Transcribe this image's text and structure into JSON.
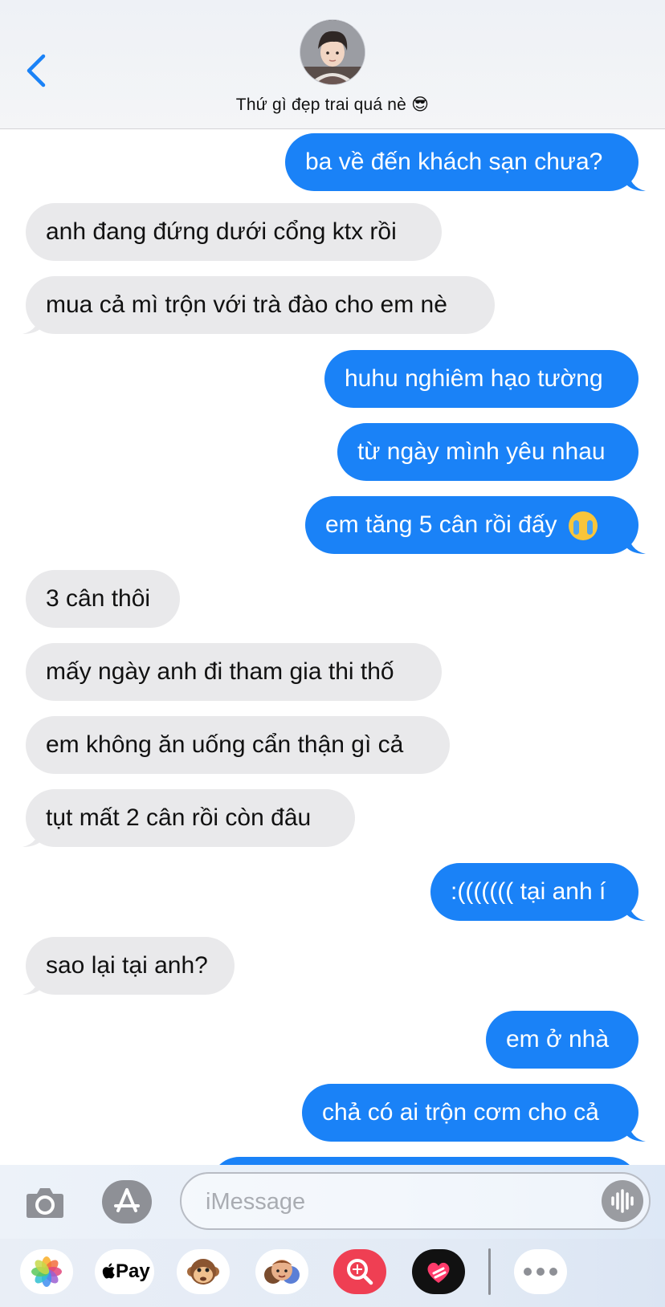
{
  "header": {
    "contact_name": "Thứ gì đẹp trai quá nè 😎",
    "back_icon": "chevron-left-icon",
    "accent_color": "#1a82f7"
  },
  "messages": [
    {
      "dir": "out",
      "text": "ba về đến khách sạn chưa?"
    },
    {
      "dir": "in",
      "text": "anh đang đứng dưới cổng ktx rồi"
    },
    {
      "dir": "in",
      "text": "mua cả mì trộn với trà đào cho em nè"
    },
    {
      "dir": "out",
      "text": "huhu nghiêm hạo tường"
    },
    {
      "dir": "out",
      "text": "từ ngày mình yêu nhau"
    },
    {
      "dir": "out",
      "text": "em tăng 5 cân rồi đấy",
      "emoji": "crying-face"
    },
    {
      "dir": "in",
      "text": "3 cân thôi"
    },
    {
      "dir": "in",
      "text": "mấy ngày anh đi tham gia thi thố"
    },
    {
      "dir": "in",
      "text": "em không ăn uống cẩn thận gì cả"
    },
    {
      "dir": "in",
      "text": "tụt mất 2 cân rồi còn đâu"
    },
    {
      "dir": "out",
      "text": ":((((((( tại anh í"
    },
    {
      "dir": "in",
      "text": "sao lại tại anh?"
    },
    {
      "dir": "out",
      "text": "em ở nhà"
    },
    {
      "dir": "out",
      "text": "chả có ai trộn cơm cho cả"
    }
  ],
  "input": {
    "placeholder": "iMessage",
    "value": ""
  },
  "apps": {
    "photos": "photos-icon",
    "apple_pay_label": "Pay",
    "memoji": "monkey-memoji-icon",
    "stickers": "memoji-stickers-icon",
    "search": "image-search-icon",
    "digital_touch": "digital-touch-heart-icon",
    "more": "more-icon"
  },
  "colors": {
    "outgoing_bubble": "#1a82f7",
    "incoming_bubble": "#e9e9eb"
  }
}
